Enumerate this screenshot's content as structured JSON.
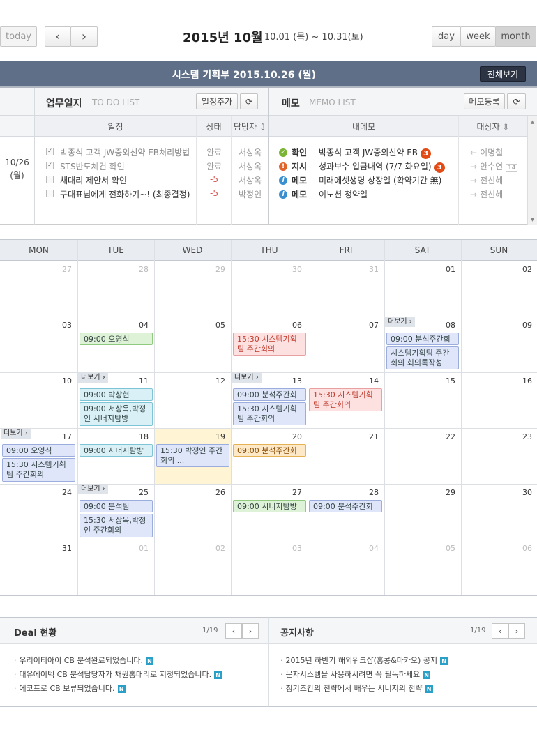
{
  "toolbar": {
    "today": "today",
    "prev": "‹",
    "next": "›",
    "title": "2015년 10월",
    "range": "- 10.01 (목) ~ 10.31(토)",
    "views": [
      "day",
      "week",
      "month"
    ]
  },
  "header": {
    "title": "시스템 기획부 2015.10.26 (월)",
    "all_button": "전체보기"
  },
  "todo": {
    "title": "업무일지",
    "sub": "TO DO LIST",
    "add_button": "일정추가",
    "cols": [
      "일정",
      "상태",
      "담당자 ⇳"
    ],
    "date": "10/26",
    "day": "(월)",
    "items": [
      {
        "text": "박종식 고객 JW중외신약 EB처리방법",
        "status": "완료",
        "owner": "서상옥",
        "done": true
      },
      {
        "text": "STS반도체건 확인",
        "status": "완료",
        "owner": "서상옥",
        "done": true
      },
      {
        "text": "채대리 제안서 확인",
        "status": "-5",
        "owner": "서상옥",
        "done": false
      },
      {
        "text": "구대표님에게 전화하기~! (최종결정)",
        "status": "-5",
        "owner": "박정인",
        "done": false
      }
    ]
  },
  "memo": {
    "title": "메모",
    "sub": "MEMO LIST",
    "add_button": "메모등록",
    "cols": [
      "내메모",
      "대상자 ⇳"
    ],
    "items": [
      {
        "type": "확인",
        "text": "박종식 고객 JW중외신약 EB",
        "badge": "3",
        "target": "이명철",
        "extra": ""
      },
      {
        "type": "지시",
        "text": "성과보수 입금내역 (7/7 화요일)",
        "badge": "3",
        "target": "안수연",
        "extra": "14"
      },
      {
        "type": "메모",
        "text": "미래에셋생명 상장일 (확약기간 無)",
        "badge": "",
        "target": "전신혜",
        "extra": ""
      },
      {
        "type": "메모",
        "text": "이노션 청약일",
        "badge": "",
        "target": "전신혜",
        "extra": ""
      }
    ]
  },
  "calendar": {
    "days": [
      "MON",
      "TUE",
      "WED",
      "THU",
      "FRI",
      "SAT",
      "SUN"
    ],
    "weeks": [
      [
        "27",
        "28",
        "29",
        "30",
        "31",
        "01",
        "02"
      ],
      [
        "03",
        "04",
        "05",
        "06",
        "07",
        "08",
        "09"
      ],
      [
        "10",
        "11",
        "12",
        "13",
        "14",
        "15",
        "16"
      ],
      [
        "17",
        "18",
        "19",
        "20",
        "21",
        "22",
        "23"
      ],
      [
        "24",
        "25",
        "26",
        "27",
        "28",
        "29",
        "30"
      ],
      [
        "31",
        "01",
        "02",
        "03",
        "04",
        "05",
        "06"
      ]
    ],
    "more": "더보기 ›",
    "events": {
      "e1": "09:00 오영식",
      "e2": "15:30 시스템기획팀 주간회의",
      "e3": "09:00 분석주간회의",
      "e4": "시스템기획팀 주간 회의 회의록작성",
      "e5": "09:00 박상현",
      "e6": "09:00 서상옥,박정인 시너지탐방",
      "e7": "09:00 분석주간회의",
      "e8": "15:30 시스템기획팀 주간회의",
      "e9": "15:30 시스템기획팀 주간회의",
      "e10": "09:00 오영식",
      "e11": "15:30 시스템기획팀 주간회의",
      "e12": "09:00 시너지탐방",
      "e13": "15:30 박정인 주간회의 ...",
      "e14": "09:00 분석주간회의",
      "e15": "09:00 분석팀",
      "e16": "15:30 서상옥,박정인 주간회의",
      "e17": "09:00 시너지탐방",
      "e18": "09:00 분석주간회의"
    }
  },
  "deal": {
    "title": "Deal 현황",
    "page": "1/19",
    "items": [
      "우리이티아이 CB 분석완료되었습니다.",
      "대유에이텍 CB 분석담당자가 채원홍대리로 지정되었습니다.",
      "에코프로 CB 보류되었습니다."
    ]
  },
  "notice": {
    "title": "공지사항",
    "page": "1/19",
    "items": [
      "2015년 하반기 해외워크샵(홍콩&마카오) 공지",
      "문자시스템을 사용하시려면 꼭 필독하세요",
      "칭기즈칸의 전략에서 배우는 시너지의 전략"
    ]
  },
  "new_badge": "N"
}
